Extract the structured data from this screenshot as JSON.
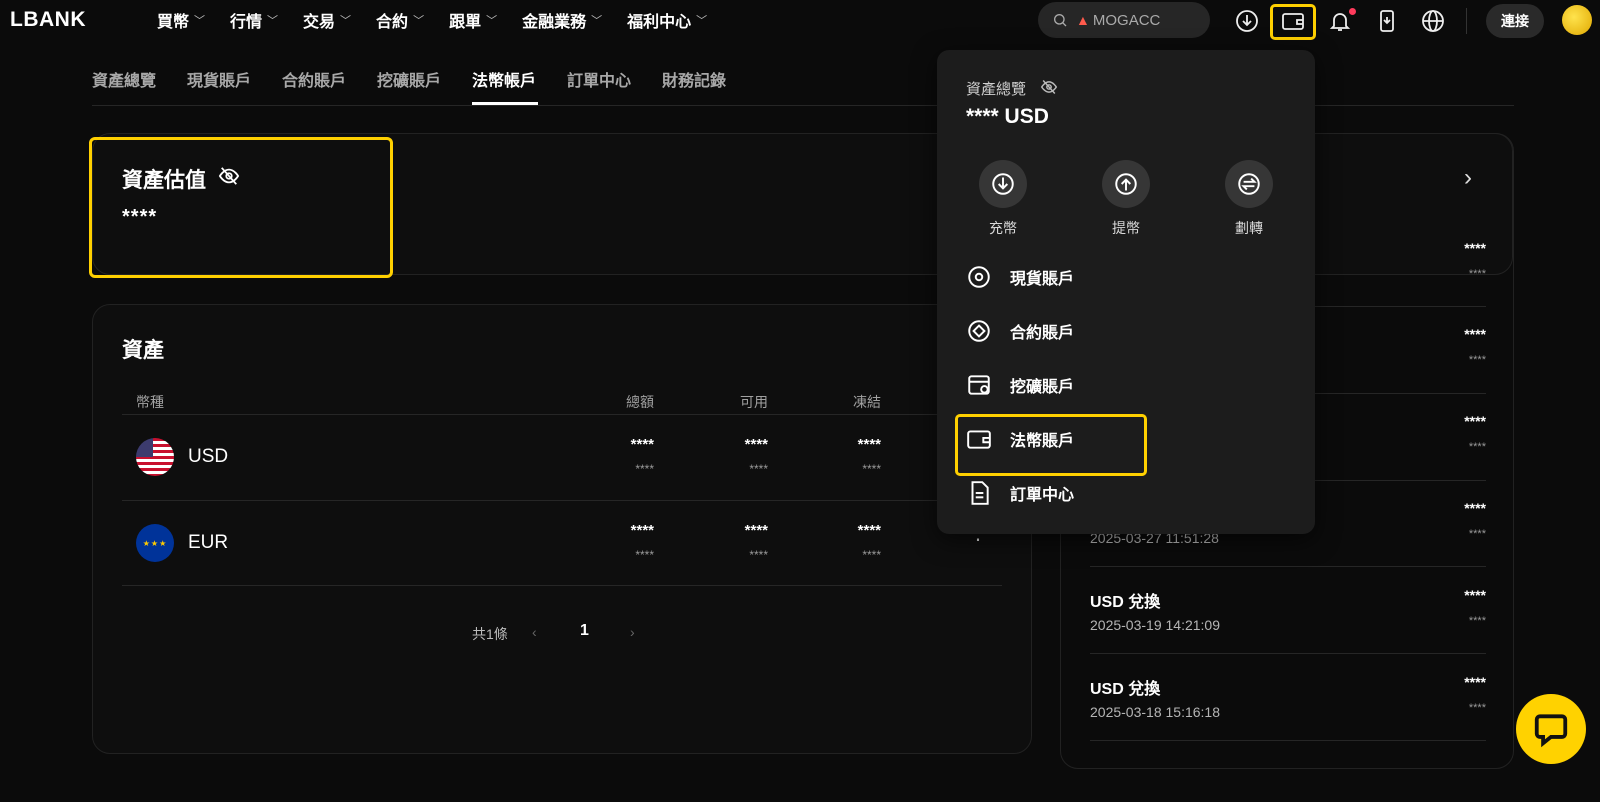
{
  "brand": {
    "logo": "LBANK",
    "accent": "#ffd000"
  },
  "nav": {
    "items": [
      {
        "label": "買幣"
      },
      {
        "label": "行情"
      },
      {
        "label": "交易"
      },
      {
        "label": "合約"
      },
      {
        "label": "跟單"
      },
      {
        "label": "金融業務"
      },
      {
        "label": "福利中心"
      }
    ]
  },
  "header": {
    "search_value": "MOGACC",
    "connect_label": "連接",
    "icons": [
      "download-icon",
      "wallet-icon",
      "bell-icon",
      "mobile-app-icon",
      "globe-icon"
    ]
  },
  "subtabs": [
    {
      "label": "資產總覽"
    },
    {
      "label": "現貨賬戶"
    },
    {
      "label": "合約賬戶"
    },
    {
      "label": "挖礦賬戶"
    },
    {
      "label": "法幣帳戶",
      "active": true
    },
    {
      "label": "訂單中心"
    },
    {
      "label": "財務記錄"
    }
  ],
  "estimate": {
    "title": "資產估值",
    "value": "****"
  },
  "assets": {
    "title": "資產",
    "columns": {
      "currency": "幣種",
      "total": "總額",
      "available": "可用",
      "frozen": "凍結"
    },
    "rows": [
      {
        "currency": "USD",
        "total": "****",
        "total_sub": "****",
        "available": "****",
        "available_sub": "****",
        "frozen": "****",
        "frozen_sub": "****"
      },
      {
        "currency": "EUR",
        "total": "****",
        "total_sub": "****",
        "available": "****",
        "available_sub": "****",
        "frozen": "****",
        "frozen_sub": "****"
      }
    ],
    "pagination": {
      "total_label": "共1條",
      "current": "1"
    }
  },
  "history": {
    "rows": [
      {
        "amount": "****",
        "sub": "****"
      },
      {
        "amount": "****",
        "sub": "****"
      },
      {
        "amount": "****",
        "sub": "****"
      },
      {
        "time": "2025-03-27 11:51:28",
        "amount": "****",
        "sub": "****"
      },
      {
        "title": "USD 兌換",
        "time": "2025-03-19 14:21:09",
        "amount": "****",
        "sub": "****"
      },
      {
        "title": "USD 兌換",
        "time": "2025-03-18 15:16:18",
        "amount": "****",
        "sub": "****"
      }
    ]
  },
  "dropdown": {
    "overview_label": "資產總覽",
    "overview_value": "**** USD",
    "actions": [
      {
        "label": "充幣",
        "icon": "deposit-icon"
      },
      {
        "label": "提幣",
        "icon": "withdraw-icon"
      },
      {
        "label": "劃轉",
        "icon": "transfer-icon"
      }
    ],
    "items": [
      {
        "label": "現貨賬戶",
        "icon": "spot-account-icon"
      },
      {
        "label": "合約賬戶",
        "icon": "futures-account-icon"
      },
      {
        "label": "挖礦賬戶",
        "icon": "mining-account-icon"
      },
      {
        "label": "法幣賬戶",
        "icon": "fiat-account-icon"
      },
      {
        "label": "訂單中心",
        "icon": "order-center-icon"
      }
    ]
  }
}
